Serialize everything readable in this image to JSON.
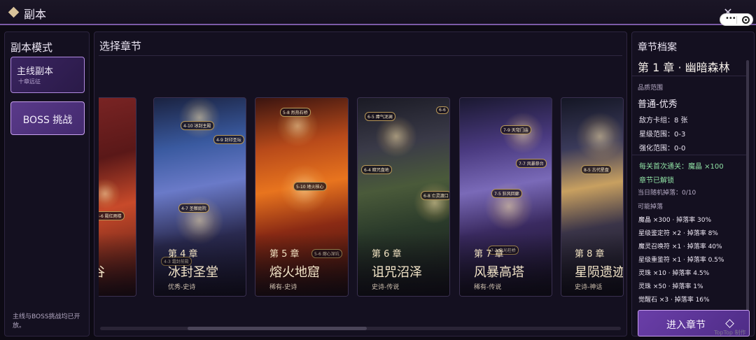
{
  "window": {
    "title": "副本"
  },
  "left": {
    "heading": "副本模式",
    "mode_main": {
      "title": "主线副本",
      "subtitle": "十章远征"
    },
    "boss_button": "BOSS 挑战",
    "note": "主线与BOSS挑战均已开放。"
  },
  "middle": {
    "heading": "选择章节",
    "chapters": [
      {
        "num": "",
        "name": "谷",
        "rarity": "",
        "nodes": [
          "3-6 殿红雨楼"
        ]
      },
      {
        "num": "第 4 章",
        "name": "冰封圣堂",
        "rarity": "优秀-史诗",
        "nodes": [
          "4-10 冰封主殿",
          "4-9 封印圣坛",
          "4-7 圣徽庭院",
          "4-3 霜封前殿"
        ]
      },
      {
        "num": "第 5 章",
        "name": "熔火地窟",
        "rarity": "稀有-史诗",
        "nodes": [
          "5-8 烈热石桥",
          "5-10 地火核心",
          "5-6 熔心深坑"
        ]
      },
      {
        "num": "第 6 章",
        "name": "诅咒沼泽",
        "rarity": "史诗-传说",
        "nodes": [
          "6-5 瘴气泥澜",
          "6-6",
          "6-4 暗咒盘地",
          "6-8 亡灵渡口"
        ]
      },
      {
        "num": "第 7 章",
        "name": "风暴高塔",
        "rarity": "稀有-传说",
        "nodes": [
          "7-9 天穹门庙",
          "7-7 风暴祭台",
          "7-5 狂风回廊",
          "7-2 电光柱桥"
        ]
      },
      {
        "num": "第 8 章",
        "name": "星陨遗迹",
        "rarity": "史诗-神话",
        "nodes": [
          "8-5 古代星盘"
        ]
      }
    ]
  },
  "right": {
    "heading": "章节档案",
    "chapter_title": "第 1 章 · 幽暗森林",
    "quality_label": "品质范围",
    "quality_value": "普通-优秀",
    "stats": [
      "敌方卡组：8 张",
      "星级范围：0-3",
      "强化范围：0-0"
    ],
    "first_clear": "每关首次通关：魔晶 ×100",
    "unlocked": "章节已解锁",
    "daily_drop": "当日随机掉落：0/10",
    "drops_label": "可能掉落",
    "drops": [
      "魔晶 ×300 · 掉落率 30%",
      "星级鉴定符 ×2 · 掉落率 8%",
      "魔灵召唤符 ×1 · 掉落率 40%",
      "星级重鉴符 ×1 · 掉落率 0.5%",
      "灵珠 ×10 · 掉落率 4.5%",
      "灵珠 ×50 · 掉落率 1%",
      "觉醒石 ×3 · 掉落率 16%"
    ],
    "enter_button": "进入章节"
  },
  "watermark": "TopTop 制作",
  "colors": {
    "accent": "#7b5aa6",
    "gold": "#d8c29a",
    "unlocked_green": "#8fe0a4",
    "button": "#5a3494"
  }
}
